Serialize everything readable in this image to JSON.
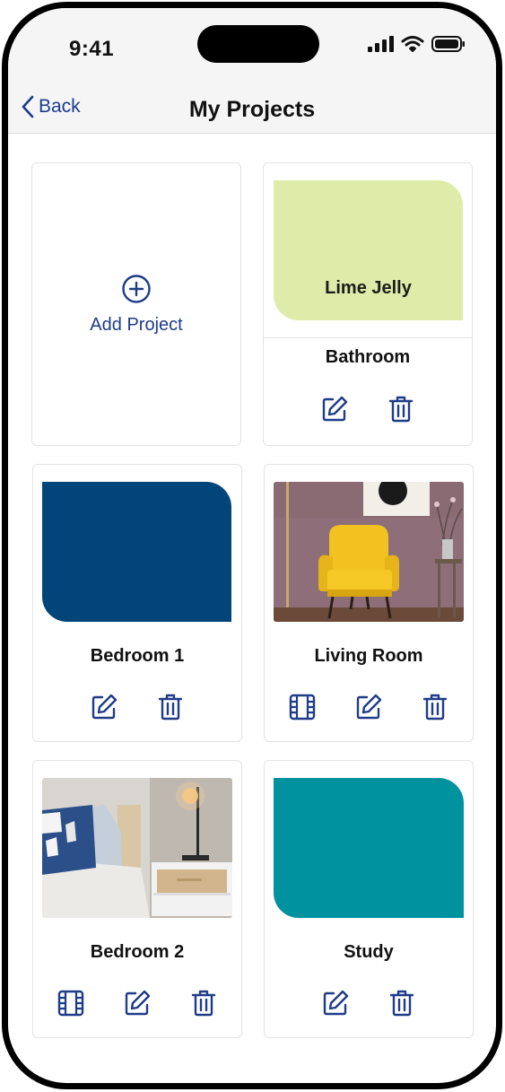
{
  "status_bar": {
    "time": "9:41"
  },
  "nav": {
    "back_label": "Back",
    "title": "My Projects"
  },
  "add_project": {
    "label": "Add Project"
  },
  "projects": [
    {
      "name": "Bathroom",
      "swatch_label": "Lime Jelly",
      "swatch_color": "#dfeba8",
      "actions": [
        "edit-icon",
        "trash-icon"
      ]
    },
    {
      "name": "Bedroom 1",
      "swatch_color": "#02457a",
      "actions": [
        "edit-icon",
        "trash-icon"
      ]
    },
    {
      "name": "Living Room",
      "photo": "armchair-room-photo",
      "actions": [
        "film-icon",
        "edit-icon",
        "trash-icon"
      ]
    },
    {
      "name": "Bedroom 2",
      "photo": "bedroom-photo",
      "actions": [
        "film-icon",
        "edit-icon",
        "trash-icon"
      ]
    },
    {
      "name": "Study",
      "swatch_color": "#00929f",
      "actions": [
        "edit-icon",
        "trash-icon"
      ]
    }
  ],
  "colors": {
    "accent": "#1a3a8c",
    "icon": "#1f3c88"
  }
}
